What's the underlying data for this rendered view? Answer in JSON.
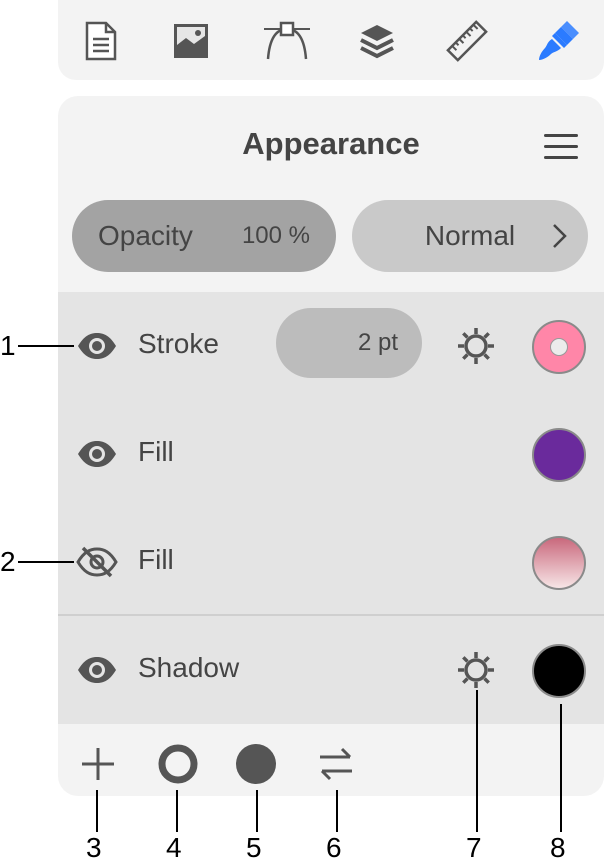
{
  "toolbar": {
    "icons": [
      "document-icon",
      "image-icon",
      "bezier-path-icon",
      "layers-icon",
      "ruler-icon",
      "paintbrush-icon"
    ],
    "active_color": "#2b7bff"
  },
  "panel": {
    "title": "Appearance",
    "opacity_label": "Opacity",
    "opacity_value": "100 %",
    "blend_mode": "Normal"
  },
  "rows": [
    {
      "label": "Stroke",
      "visible": true,
      "width": "2 pt",
      "swatch": "#ff86a8"
    },
    {
      "label": "Fill",
      "visible": true,
      "swatch": "#6a2a9c"
    },
    {
      "label": "Fill",
      "visible": false,
      "swatch": "gradient-pink"
    },
    {
      "label": "Shadow",
      "visible": true,
      "swatch": "#000000"
    }
  ],
  "footer": {
    "icons": [
      "add-icon",
      "stroke-ring-icon",
      "fill-circle-icon",
      "swap-icon"
    ]
  },
  "callouts": [
    "1",
    "2",
    "3",
    "4",
    "5",
    "6",
    "7",
    "8"
  ]
}
